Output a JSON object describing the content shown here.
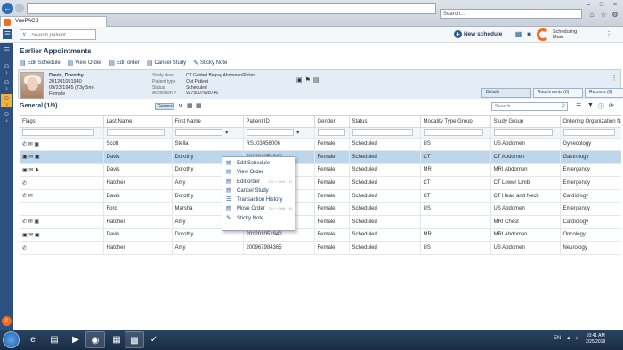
{
  "browser": {
    "address": "",
    "search_placeholder": "Search...",
    "tab_title": "VuePACS"
  },
  "app": {
    "patient_search_placeholder": "Search patient",
    "new_schedule_label": "New schedule",
    "user_role": "Scheduling",
    "user_name": "Main"
  },
  "nav": {
    "items": [
      {
        "icon": "☰",
        "sub": ""
      },
      {
        "icon": "☺",
        "sub": "1"
      },
      {
        "icon": "☺",
        "sub": "2"
      },
      {
        "icon": "☺",
        "sub": "3"
      },
      {
        "icon": "☺",
        "sub": "4"
      }
    ]
  },
  "page": {
    "title": "Earlier Appointments"
  },
  "toolbar": {
    "edit_schedule": "Edit Schedule",
    "view_order": "View Order",
    "edit_order": "Edit order",
    "cancel_study": "Cancel Study",
    "sticky_note": "Sticky Note"
  },
  "patient": {
    "name": "Davis, Dorothy",
    "id": "201201051940",
    "dob": "09/23/1945 (73y 5m)",
    "gender": "Female",
    "study_labels": [
      "Study desc",
      "Patient type",
      "Status",
      "Accession #"
    ],
    "study_values": [
      "CT Guided Biopsy Abdomen/Pelvis",
      "Out Patient",
      "Scheduled",
      "9275007628746"
    ]
  },
  "panel_tabs": {
    "details": "Details",
    "attachments": "Attachments (0)",
    "records": "Records (0)"
  },
  "grid": {
    "title": "General (1/9)",
    "chip": "General",
    "search_placeholder": "Search",
    "columns": [
      "Flags",
      "Last Name",
      "First Name",
      "Patient ID",
      "Gender",
      "Status",
      "Modality Type Group",
      "Study Group",
      "Ordering Organization Name"
    ],
    "rows": [
      {
        "flags": "✆ ✉ ▣",
        "last": "Scott",
        "first": "Stella",
        "pid": "RS103456006",
        "gender": "Female",
        "status": "Scheduled",
        "modality": "US",
        "study_group": "US Abdomen",
        "org": "Gynecology"
      },
      {
        "flags": "▣ ✉ ▣",
        "last": "Davis",
        "first": "Dorothy",
        "pid": "201201051940",
        "gender": "Female",
        "status": "Scheduled",
        "modality": "CT",
        "study_group": "CT Abdomen",
        "org": "Gastrology"
      },
      {
        "flags": "▣ ✉ ♟",
        "last": "Davis",
        "first": "Dorothy",
        "pid": "",
        "gender": "Female",
        "status": "Scheduled",
        "modality": "MR",
        "study_group": "MRI Abdomen",
        "org": "Emergency"
      },
      {
        "flags": "✆",
        "last": "Hatcher",
        "first": "Amy",
        "pid": "",
        "gender": "Female",
        "status": "Scheduled",
        "modality": "CT",
        "study_group": "CT Lower Limb",
        "org": "Emergency"
      },
      {
        "flags": "✆ ✉",
        "last": "Davis",
        "first": "Dorothy",
        "pid": "",
        "gender": "Female",
        "status": "Scheduled",
        "modality": "CT",
        "study_group": "CT Head and Neck",
        "org": "Cardiology"
      },
      {
        "flags": "",
        "last": "Ford",
        "first": "Marsha",
        "pid": "",
        "gender": "Female",
        "status": "Scheduled",
        "modality": "US",
        "study_group": "US Abdomen",
        "org": "Emergency"
      },
      {
        "flags": "✆ ✉ ▣",
        "last": "Hatcher",
        "first": "Amy",
        "pid": "",
        "gender": "Female",
        "status": "Scheduled",
        "modality": "",
        "study_group": "MRI Chest",
        "org": "Cardiology"
      },
      {
        "flags": "▣ ✉ ▣",
        "last": "Davis",
        "first": "Dorothy",
        "pid": "201201051940",
        "gender": "Female",
        "status": "Scheduled",
        "modality": "MR",
        "study_group": "MRI Abdomen",
        "org": "Oncology"
      },
      {
        "flags": "✆",
        "last": "Hatcher",
        "first": "Amy",
        "pid": "200967984365",
        "gender": "Female",
        "status": "Scheduled",
        "modality": "US",
        "study_group": "US Abdomen",
        "org": "Neurology"
      }
    ]
  },
  "context_menu": {
    "items": [
      {
        "icon": "▤",
        "label": "Edit Schedule",
        "shortcut": ""
      },
      {
        "icon": "▤",
        "label": "View Order",
        "shortcut": ""
      },
      {
        "icon": "▤",
        "label": "Edit order",
        "shortcut": "Ctrl + Shift + O"
      },
      {
        "icon": "▤",
        "label": "Cancel Study",
        "shortcut": ""
      },
      {
        "icon": "☰",
        "label": "Transaction History",
        "shortcut": ""
      },
      {
        "icon": "▤",
        "label": "Move Order",
        "shortcut": "Ctrl + Shift + M"
      },
      {
        "icon": "✎",
        "label": "Sticky Note",
        "shortcut": ""
      }
    ]
  },
  "taskbar": {
    "time": "10:41 AM",
    "date": "2/25/2019",
    "lang": "EN"
  },
  "colors": {
    "nav_bg": "#2c5180",
    "accent_orange": "#f36c21",
    "selected_row": "#bcd6ec",
    "panel_bg": "#e4edf5"
  }
}
